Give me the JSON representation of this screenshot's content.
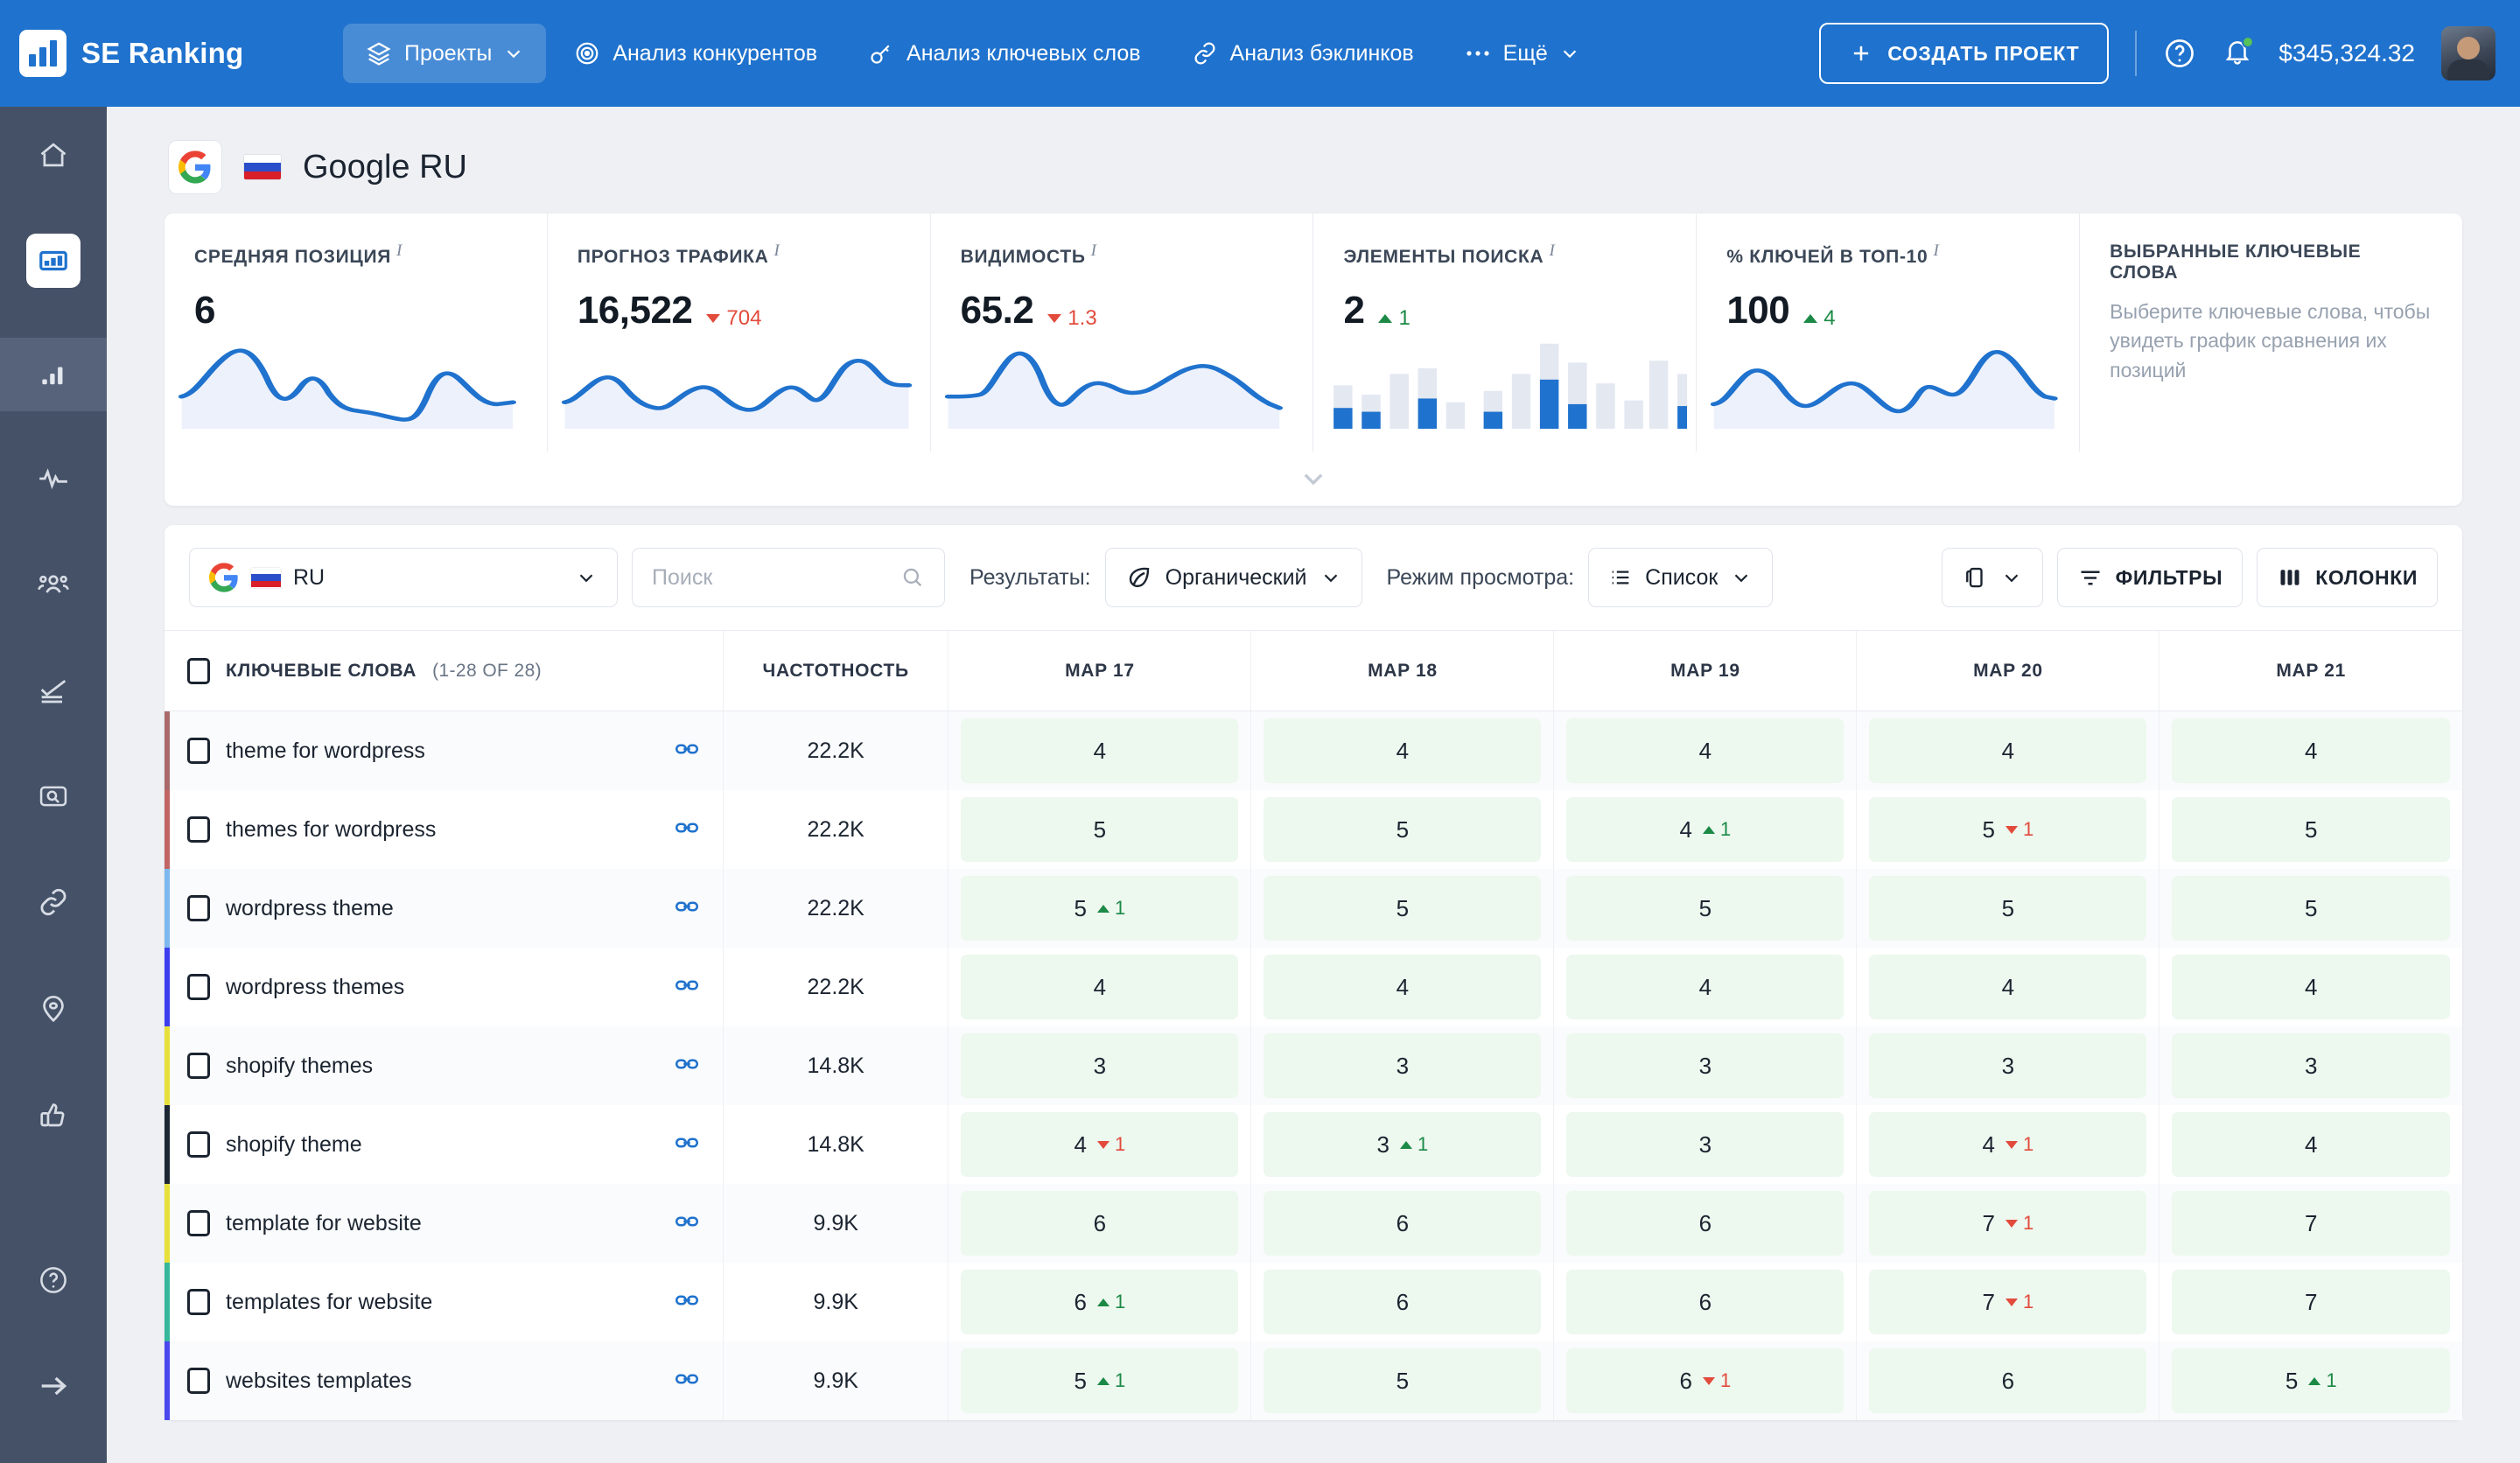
{
  "app": {
    "brand": "SE Ranking",
    "balance": "$345,324.32",
    "create_button": "СОЗДАТЬ ПРОЕКТ"
  },
  "nav": [
    {
      "label": "Проекты",
      "icon": "layers-icon",
      "active": true,
      "caret": true
    },
    {
      "label": "Анализ конкурентов",
      "icon": "target-icon",
      "active": false,
      "caret": false
    },
    {
      "label": "Анализ ключевых слов",
      "icon": "key-icon",
      "active": false,
      "caret": false
    },
    {
      "label": "Анализ бэклинков",
      "icon": "link-icon",
      "active": false,
      "caret": false
    },
    {
      "label": "Ещё",
      "icon": "dots-icon",
      "active": false,
      "caret": true
    }
  ],
  "sidebar": {
    "items": [
      {
        "name": "home-icon",
        "state": "normal"
      },
      {
        "name": "dashboard-icon",
        "state": "selected"
      },
      {
        "name": "rankings-bar-icon",
        "state": "highlighted"
      },
      {
        "name": "pulse-icon",
        "state": "normal"
      },
      {
        "name": "competitors-icon",
        "state": "normal"
      },
      {
        "name": "checklist-icon",
        "state": "normal"
      },
      {
        "name": "site-audit-icon",
        "state": "normal"
      },
      {
        "name": "backlinks-icon",
        "state": "normal"
      },
      {
        "name": "local-marketing-icon",
        "state": "normal"
      },
      {
        "name": "social-icon",
        "state": "normal"
      }
    ],
    "bottom": [
      {
        "name": "help-icon"
      },
      {
        "name": "collapse-arrow-icon"
      }
    ]
  },
  "project": {
    "title": "Google RU",
    "engine_icon": "google-icon",
    "flag": "ru-flag"
  },
  "kpis": [
    {
      "label": "СРЕДНЯЯ ПОЗИЦИЯ",
      "value": "6",
      "delta": "",
      "direction": "none",
      "chart": "line"
    },
    {
      "label": "ПРОГНОЗ ТРАФИКА",
      "value": "16,522",
      "delta": "704",
      "direction": "down",
      "chart": "line"
    },
    {
      "label": "ВИДИМОСТЬ",
      "value": "65.2",
      "delta": "1.3",
      "direction": "down",
      "chart": "line"
    },
    {
      "label": "ЭЛЕМЕНТЫ ПОИСКА",
      "value": "2",
      "delta": "1",
      "direction": "up",
      "chart": "bar"
    },
    {
      "label": "% КЛЮЧЕЙ В ТОП-10",
      "value": "100",
      "delta": "4",
      "direction": "up",
      "chart": "line"
    }
  ],
  "kpi_note": {
    "title": "ВЫБРАННЫЕ КЛЮЧЕВЫЕ СЛОВА",
    "body": "Выберите ключевые слова, чтобы увидеть график сравнения их позиций"
  },
  "toolbar": {
    "locale": "RU",
    "search_placeholder": "Поиск",
    "results_label": "Результаты:",
    "results_value": "Органический",
    "viewmode_label": "Режим просмотра:",
    "viewmode_value": "Список",
    "filters_label": "ФИЛЬТРЫ",
    "columns_label": "КОЛОНКИ"
  },
  "table": {
    "headers": {
      "keywords": "КЛЮЧЕВЫЕ СЛОВА",
      "keywords_count": "(1-28 OF 28)",
      "frequency": "ЧАСТОТНОСТЬ",
      "dates": [
        "MAP 17",
        "MAP 18",
        "MAP 19",
        "MAP 20",
        "MAP 21"
      ]
    },
    "rows": [
      {
        "keyword": "theme for wordpress",
        "stripe": "#a9696b",
        "frequency": "22.2K",
        "positions": [
          {
            "v": "4"
          },
          {
            "v": "4"
          },
          {
            "v": "4"
          },
          {
            "v": "4"
          },
          {
            "v": "4"
          }
        ]
      },
      {
        "keyword": "themes for wordpress",
        "stripe": "#c06464",
        "frequency": "22.2K",
        "positions": [
          {
            "v": "5"
          },
          {
            "v": "5"
          },
          {
            "v": "4",
            "d": "1",
            "dir": "up"
          },
          {
            "v": "5",
            "d": "1",
            "dir": "down"
          },
          {
            "v": "5"
          }
        ]
      },
      {
        "keyword": "wordpress theme",
        "stripe": "#7cb8ee",
        "frequency": "22.2K",
        "positions": [
          {
            "v": "5",
            "d": "1",
            "dir": "up"
          },
          {
            "v": "5"
          },
          {
            "v": "5"
          },
          {
            "v": "5"
          },
          {
            "v": "5"
          }
        ]
      },
      {
        "keyword": "wordpress themes",
        "stripe": "#3d3df0",
        "frequency": "22.2K",
        "positions": [
          {
            "v": "4"
          },
          {
            "v": "4"
          },
          {
            "v": "4"
          },
          {
            "v": "4"
          },
          {
            "v": "4"
          }
        ]
      },
      {
        "keyword": "shopify themes",
        "stripe": "#e8e03a",
        "frequency": "14.8K",
        "positions": [
          {
            "v": "3"
          },
          {
            "v": "3"
          },
          {
            "v": "3"
          },
          {
            "v": "3"
          },
          {
            "v": "3"
          }
        ]
      },
      {
        "keyword": "shopify theme",
        "stripe": "#1d2733",
        "frequency": "14.8K",
        "positions": [
          {
            "v": "4",
            "d": "1",
            "dir": "down"
          },
          {
            "v": "3",
            "d": "1",
            "dir": "up"
          },
          {
            "v": "3"
          },
          {
            "v": "4",
            "d": "1",
            "dir": "down"
          },
          {
            "v": "4"
          }
        ]
      },
      {
        "keyword": "template for website",
        "stripe": "#e8e03a",
        "frequency": "9.9K",
        "positions": [
          {
            "v": "6"
          },
          {
            "v": "6"
          },
          {
            "v": "6"
          },
          {
            "v": "7",
            "d": "1",
            "dir": "down"
          },
          {
            "v": "7"
          }
        ]
      },
      {
        "keyword": "templates for website",
        "stripe": "#34b79a",
        "frequency": "9.9K",
        "positions": [
          {
            "v": "6",
            "d": "1",
            "dir": "up"
          },
          {
            "v": "6"
          },
          {
            "v": "6"
          },
          {
            "v": "7",
            "d": "1",
            "dir": "down"
          },
          {
            "v": "7"
          }
        ]
      },
      {
        "keyword": "websites templates",
        "stripe": "#4a47ef",
        "frequency": "9.9K",
        "positions": [
          {
            "v": "5",
            "d": "1",
            "dir": "up"
          },
          {
            "v": "5"
          },
          {
            "v": "6",
            "d": "1",
            "dir": "down"
          },
          {
            "v": "6"
          },
          {
            "v": "5",
            "d": "1",
            "dir": "up"
          }
        ]
      }
    ]
  },
  "chart_data": [
    {
      "type": "line",
      "title": "СРЕДНЯЯ ПОЗИЦИЯ",
      "values": [
        30,
        62,
        78,
        42,
        28,
        50,
        46,
        32,
        26,
        22,
        18,
        14,
        34,
        66,
        52
      ],
      "ylabel": "",
      "xlabel": ""
    },
    {
      "type": "line",
      "title": "ПРОГНОЗ ТРАФИКА",
      "values": [
        30,
        38,
        58,
        48,
        30,
        36,
        50,
        52,
        38,
        28,
        40,
        54,
        46,
        38,
        74,
        60,
        46,
        44
      ],
      "ylabel": "",
      "xlabel": ""
    },
    {
      "type": "line",
      "title": "ВИДИМОСТЬ",
      "values": [
        34,
        36,
        44,
        74,
        58,
        28,
        40,
        56,
        50,
        48,
        52,
        58,
        66,
        68,
        62,
        54,
        30
      ],
      "ylabel": "",
      "xlabel": ""
    },
    {
      "type": "bar",
      "title": "ЭЛЕМЕНТЫ ПОИСКА",
      "categories": [
        "1",
        "2",
        "3",
        "4",
        "5",
        "6",
        "7",
        "8",
        "9",
        "10",
        "11",
        "12",
        "13"
      ],
      "series": [
        {
          "name": "total",
          "values": [
            46,
            36,
            58,
            64,
            28,
            40,
            58,
            90,
            70,
            48,
            30,
            72,
            58
          ]
        },
        {
          "name": "highlighted",
          "values": [
            20,
            14,
            0,
            30,
            0,
            14,
            0,
            52,
            26,
            0,
            0,
            0,
            24
          ]
        }
      ]
    },
    {
      "type": "line",
      "title": "% КЛЮЧЕЙ В ТОП-10",
      "values": [
        30,
        58,
        40,
        28,
        34,
        52,
        42,
        30,
        36,
        54,
        38,
        70,
        88,
        60,
        56
      ],
      "ylabel": "",
      "xlabel": ""
    }
  ]
}
